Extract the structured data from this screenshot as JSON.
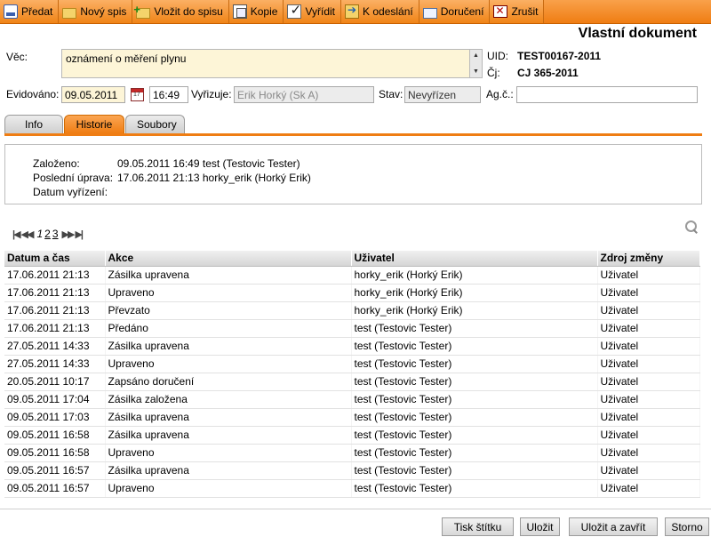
{
  "toolbar": {
    "items": [
      {
        "label": "Předat",
        "icon": "hand-over-icon"
      },
      {
        "label": "Nový spis",
        "icon": "folder-icon"
      },
      {
        "label": "Vložit do spisu",
        "icon": "folder-add-icon"
      },
      {
        "label": "Kopie",
        "icon": "copy-icon"
      },
      {
        "label": "Vyřídit",
        "icon": "checkmark-icon"
      },
      {
        "label": "K odeslání",
        "icon": "send-icon"
      },
      {
        "label": "Doručení",
        "icon": "delivery-icon"
      },
      {
        "label": "Zrušit",
        "icon": "close-icon"
      }
    ]
  },
  "document": {
    "title": "Vlastní dokument",
    "vec_label": "Věc:",
    "vec_value": "oznámení o měření plynu",
    "uid_label": "UID:",
    "uid_value": "TEST00167-2011",
    "cj_label": "Čj:",
    "cj_value": "CJ 365-2011",
    "evidovano_label": "Evidováno:",
    "evidovano_date": "09.05.2011",
    "evidovano_time": "16:49",
    "vyrizuje_label": "Vyřizuje:",
    "vyrizuje_value": "Erik Horký (Sk A)",
    "stav_label": "Stav:",
    "stav_value": "Nevyřízen",
    "agc_label": "Ag.č.:",
    "agc_value": ""
  },
  "tabs": [
    {
      "label": "Info",
      "active": false
    },
    {
      "label": "Historie",
      "active": true
    },
    {
      "label": "Soubory",
      "active": false
    }
  ],
  "info": {
    "zalozeno_label": "Založeno:",
    "zalozeno_value": "09.05.2011 16:49 test (Testovic Tester)",
    "uprava_label": "Poslední úprava:",
    "uprava_value": "17.06.2011 21:13 horky_erik (Horký Erik)",
    "vyrizeni_label": "Datum vyřízení:",
    "vyrizeni_value": ""
  },
  "pager": {
    "first": "|◀",
    "prev": "◀◀",
    "pages": [
      "1",
      "2",
      "3"
    ],
    "current": "1",
    "next": "▶▶",
    "last": "▶|"
  },
  "history": {
    "columns": [
      "Datum a čas",
      "Akce",
      "Uživatel",
      "Zdroj změny"
    ],
    "rows": [
      [
        "17.06.2011 21:13",
        "Zásilka upravena",
        "horky_erik (Horký Erik)",
        "Uživatel"
      ],
      [
        "17.06.2011 21:13",
        "Upraveno",
        "horky_erik (Horký Erik)",
        "Uživatel"
      ],
      [
        "17.06.2011 21:13",
        "Převzato",
        "horky_erik (Horký Erik)",
        "Uživatel"
      ],
      [
        "17.06.2011 21:13",
        "Předáno",
        "test (Testovic Tester)",
        "Uživatel"
      ],
      [
        "27.05.2011 14:33",
        "Zásilka upravena",
        "test (Testovic Tester)",
        "Uživatel"
      ],
      [
        "27.05.2011 14:33",
        "Upraveno",
        "test (Testovic Tester)",
        "Uživatel"
      ],
      [
        "20.05.2011 10:17",
        "Zapsáno doručení",
        "test (Testovic Tester)",
        "Uživatel"
      ],
      [
        "09.05.2011 17:04",
        "Zásilka založena",
        "test (Testovic Tester)",
        "Uživatel"
      ],
      [
        "09.05.2011 17:03",
        "Zásilka upravena",
        "test (Testovic Tester)",
        "Uživatel"
      ],
      [
        "09.05.2011 16:58",
        "Zásilka upravena",
        "test (Testovic Tester)",
        "Uživatel"
      ],
      [
        "09.05.2011 16:58",
        "Upraveno",
        "test (Testovic Tester)",
        "Uživatel"
      ],
      [
        "09.05.2011 16:57",
        "Zásilka upravena",
        "test (Testovic Tester)",
        "Uživatel"
      ],
      [
        "09.05.2011 16:57",
        "Upraveno",
        "test (Testovic Tester)",
        "Uživatel"
      ]
    ]
  },
  "buttons": {
    "print_label": "Tisk štítku",
    "save_label": "Uložit",
    "save_close_label": "Uložit a zavřít",
    "cancel_label": "Storno"
  },
  "colors": {
    "accent": "#ef7d13",
    "field_highlight": "#fdf5d7"
  }
}
